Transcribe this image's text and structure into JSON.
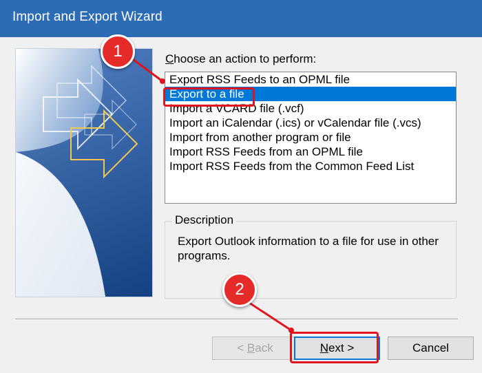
{
  "window": {
    "title": "Import and Export Wizard"
  },
  "prompt": {
    "hotkey": "C",
    "rest": "hoose an action to perform:"
  },
  "actions": {
    "items": [
      {
        "label": "Export RSS Feeds to an OPML file"
      },
      {
        "label": "Export to a file",
        "selected": true
      },
      {
        "label": "Import a VCARD file (.vcf)"
      },
      {
        "label": "Import an iCalendar (.ics) or vCalendar file (.vcs)"
      },
      {
        "label": "Import from another program or file"
      },
      {
        "label": "Import RSS Feeds from an OPML file"
      },
      {
        "label": "Import RSS Feeds from the Common Feed List"
      }
    ]
  },
  "description": {
    "legend": "Description",
    "text": "Export Outlook information to a file for use in other programs."
  },
  "buttons": {
    "back_prefix": "< ",
    "back_hotkey": "B",
    "back_rest": "ack",
    "next_hotkey": "N",
    "next_rest": "ext >",
    "cancel": "Cancel"
  },
  "annotations": {
    "step1": "1",
    "step2": "2",
    "color": "#e0141e"
  },
  "colors": {
    "titlebar": "#2b6cb5",
    "selection": "#0078d7"
  }
}
